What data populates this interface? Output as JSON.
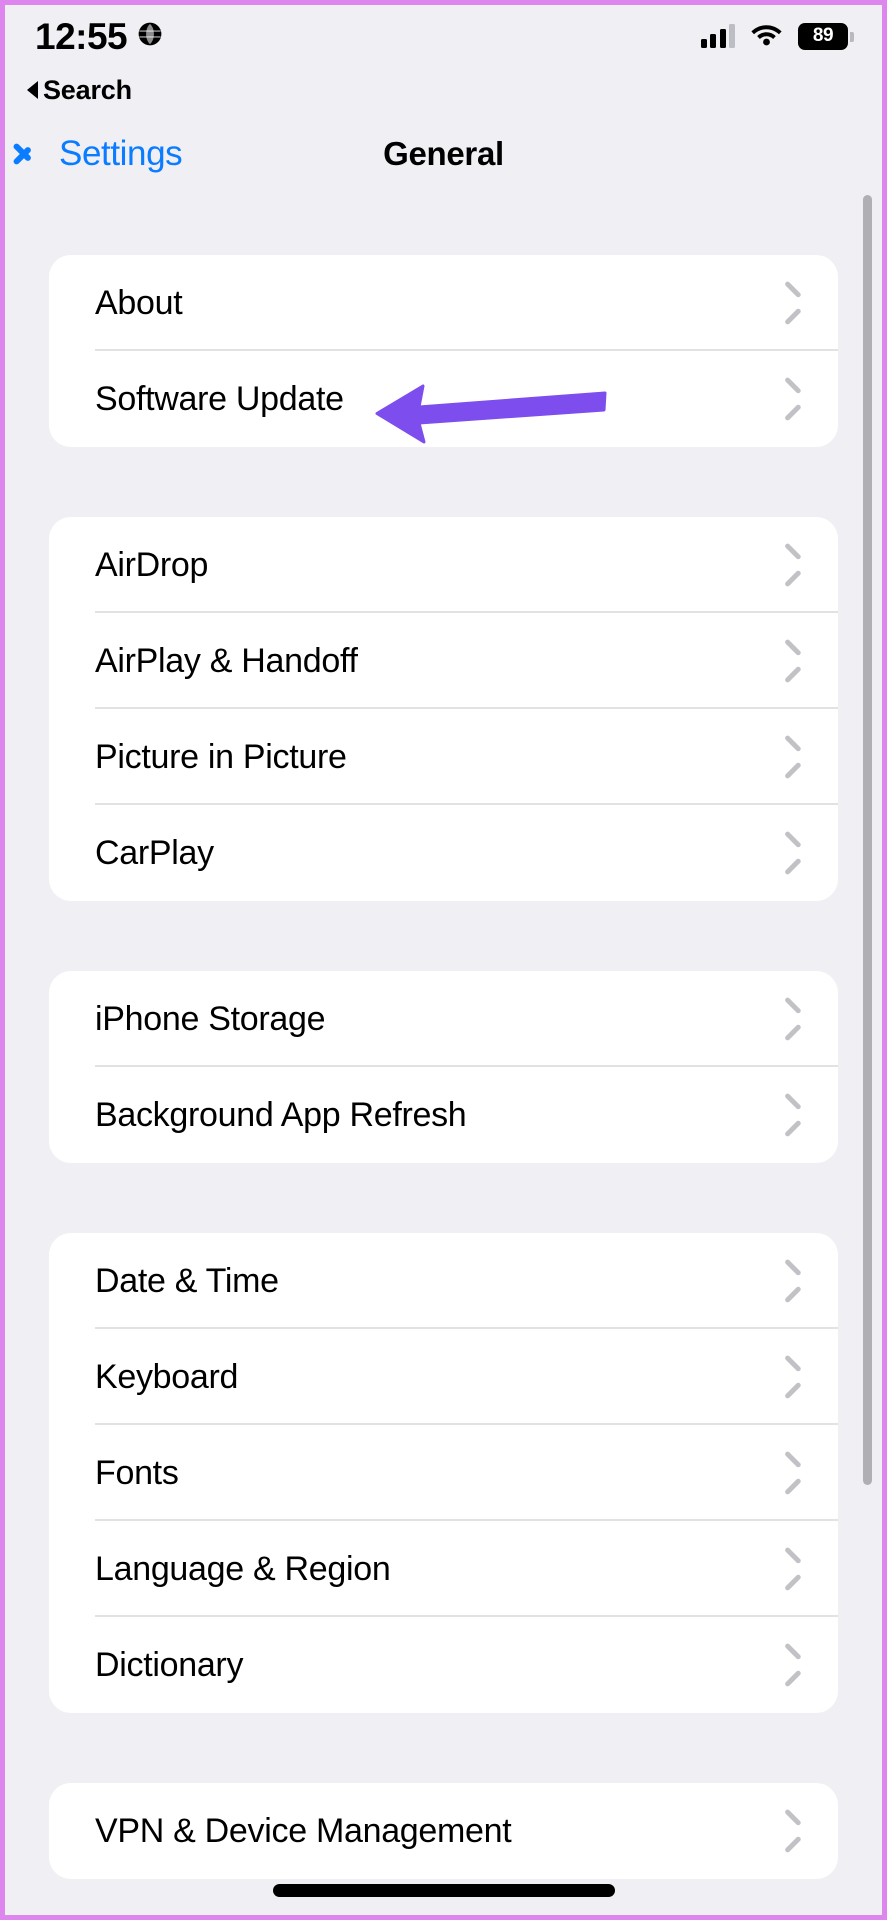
{
  "status_bar": {
    "time": "12:55",
    "location_icon": "globe-icon",
    "signal_icon": "cellular-signal-icon",
    "wifi_icon": "wifi-icon",
    "battery_level": "89",
    "battery_icon": "battery-icon"
  },
  "search_back": {
    "label": "Search",
    "icon": "back-triangle-icon"
  },
  "nav": {
    "back_label": "Settings",
    "back_icon": "chevron-left-icon",
    "title": "General"
  },
  "annotation": {
    "type": "arrow",
    "color": "#7d4ded",
    "points_to": "Software Update"
  },
  "groups": [
    {
      "items": [
        {
          "label": "About",
          "accessory": "chevron-right-icon"
        },
        {
          "label": "Software Update",
          "accessory": "chevron-right-icon"
        }
      ]
    },
    {
      "items": [
        {
          "label": "AirDrop",
          "accessory": "chevron-right-icon"
        },
        {
          "label": "AirPlay & Handoff",
          "accessory": "chevron-right-icon"
        },
        {
          "label": "Picture in Picture",
          "accessory": "chevron-right-icon"
        },
        {
          "label": "CarPlay",
          "accessory": "chevron-right-icon"
        }
      ]
    },
    {
      "items": [
        {
          "label": "iPhone Storage",
          "accessory": "chevron-right-icon"
        },
        {
          "label": "Background App Refresh",
          "accessory": "chevron-right-icon"
        }
      ]
    },
    {
      "items": [
        {
          "label": "Date & Time",
          "accessory": "chevron-right-icon"
        },
        {
          "label": "Keyboard",
          "accessory": "chevron-right-icon"
        },
        {
          "label": "Fonts",
          "accessory": "chevron-right-icon"
        },
        {
          "label": "Language & Region",
          "accessory": "chevron-right-icon"
        },
        {
          "label": "Dictionary",
          "accessory": "chevron-right-icon"
        }
      ]
    },
    {
      "items": [
        {
          "label": "VPN & Device Management",
          "accessory": "chevron-right-icon"
        }
      ]
    }
  ],
  "colors": {
    "page_background": "#f0eff4",
    "card_background": "#ffffff",
    "accent_blue": "#0a7cff",
    "separator": "#e2e2e5",
    "chevron_gray": "#c2c2c6",
    "annotation_purple": "#7d4ded",
    "frame_border": "#dd86ee"
  }
}
